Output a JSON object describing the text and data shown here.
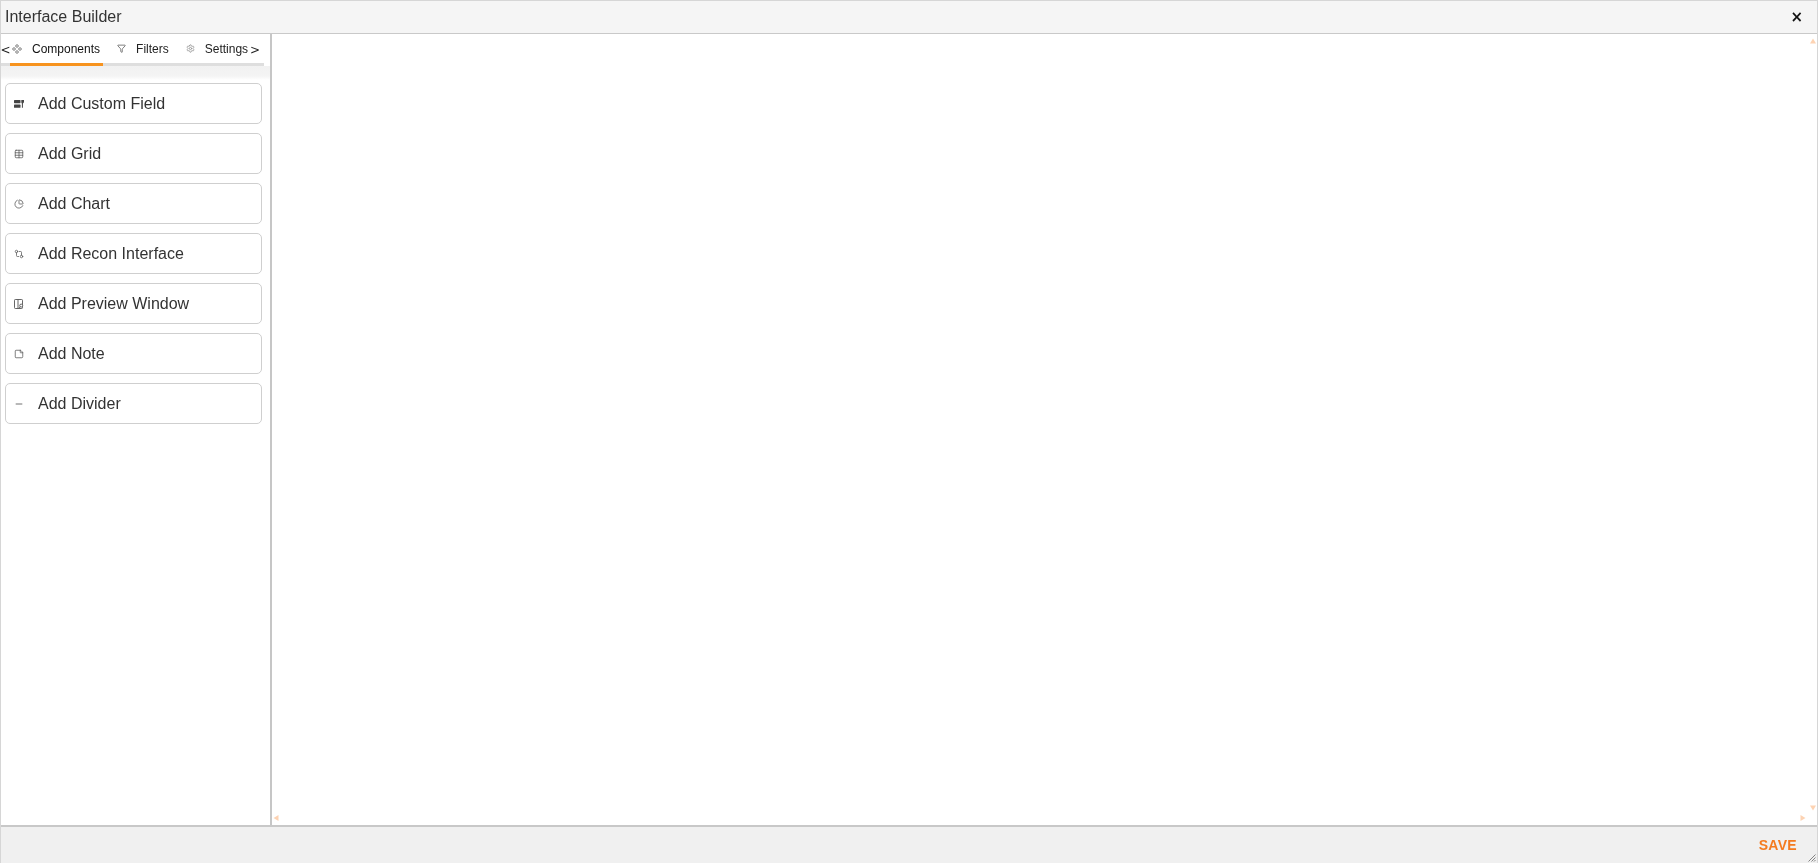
{
  "window": {
    "title": "Interface Builder",
    "close": "×"
  },
  "sidebar": {
    "tabs": {
      "prev": "<",
      "next": ">",
      "items": [
        {
          "label": "Components",
          "selected": true
        },
        {
          "label": "Filters",
          "selected": false
        },
        {
          "label": "Settings",
          "selected": false
        }
      ]
    },
    "components": [
      "Add Custom Field",
      "Add Grid",
      "Add Chart",
      "Add Recon Interface",
      "Add Preview Window",
      "Add Note",
      "Add Divider"
    ]
  },
  "footer": {
    "save": "SAVE"
  }
}
